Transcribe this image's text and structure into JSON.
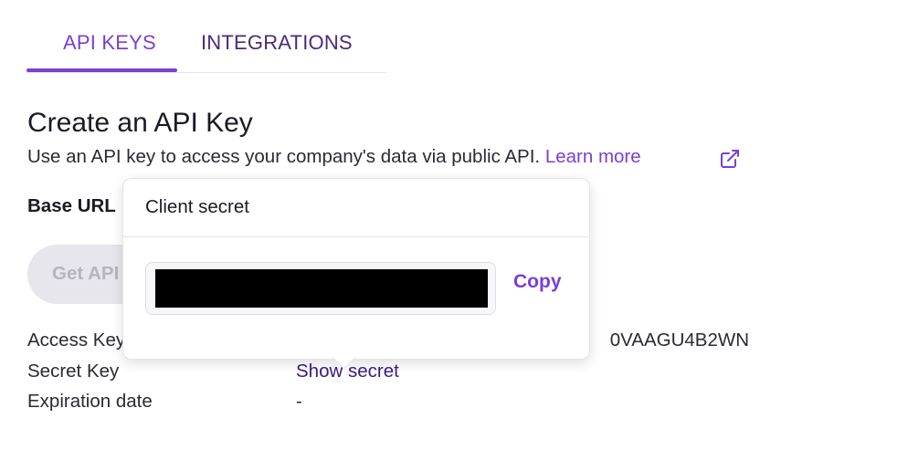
{
  "tabs": [
    {
      "label": "API KEYS",
      "active": true
    },
    {
      "label": "INTEGRATIONS",
      "active": false
    }
  ],
  "page": {
    "title": "Create an API Key",
    "description": "Use an API key to access your company's data via public API.",
    "learn_more": "Learn more",
    "learn_more_icon": "external-link-icon"
  },
  "base_url": {
    "label": "Base URL"
  },
  "get_api_button": {
    "label": "Get API"
  },
  "details": {
    "access_key": {
      "label": "Access Key",
      "value_visible_tail": "0VAAGU4B2WN"
    },
    "secret_key": {
      "label": "Secret Key",
      "action": "Show secret"
    },
    "expiration_date": {
      "label": "Expiration date",
      "value": "-"
    }
  },
  "popover": {
    "title": "Client secret",
    "secret_value": "",
    "copy_label": "Copy"
  },
  "colors": {
    "accent": "#7a3fd6",
    "link_dark": "#3b1a86",
    "disabled_bg": "#e6e6ec"
  }
}
